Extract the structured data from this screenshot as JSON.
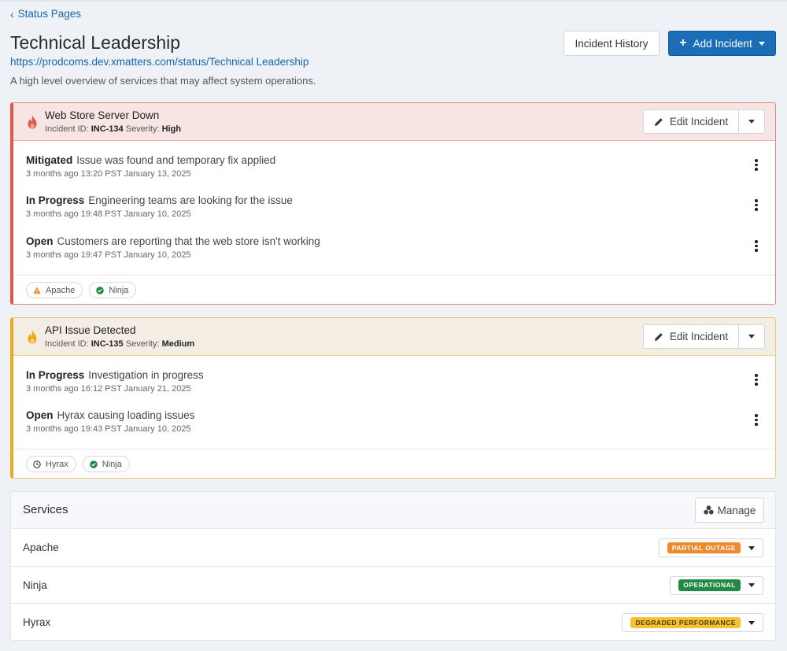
{
  "breadcrumb": {
    "label": "Status Pages"
  },
  "page": {
    "title": "Technical Leadership",
    "url": "https://prodcoms.dev.xmatters.com/status/Technical Leadership",
    "description": "A high level overview of services that may affect system operations."
  },
  "header_buttons": {
    "history": "Incident History",
    "add": "Add Incident"
  },
  "incidents": [
    {
      "title": "Web Store Server Down",
      "id_label": "Incident ID:",
      "id": "INC-134",
      "severity_label": "Severity:",
      "severity": "High",
      "edit_label": "Edit Incident",
      "accent": "#e2584a",
      "updates": [
        {
          "status": "Mitigated",
          "text": "Issue was found and temporary fix applied",
          "time": "3 months ago 13:20 PST January 13, 2025"
        },
        {
          "status": "In Progress",
          "text": "Engineering teams are looking for the issue",
          "time": "3 months ago 19:48 PST January 10, 2025"
        },
        {
          "status": "Open",
          "text": "Customers are reporting that the web store isn't working",
          "time": "3 months ago 19:47 PST January 10, 2025"
        }
      ],
      "tags": [
        {
          "label": "Apache",
          "icon": "warning-icon"
        },
        {
          "label": "Ninja",
          "icon": "check-circle-icon"
        }
      ]
    },
    {
      "title": "API Issue Detected",
      "id_label": "Incident ID:",
      "id": "INC-135",
      "severity_label": "Severity:",
      "severity": "Medium",
      "edit_label": "Edit Incident",
      "accent": "#f0a91b",
      "updates": [
        {
          "status": "In Progress",
          "text": "Investigation in progress",
          "time": "3 months ago 16:12 PST January 21, 2025"
        },
        {
          "status": "Open",
          "text": "Hyrax causing loading issues",
          "time": "3 months ago 19:43 PST January 10, 2025"
        }
      ],
      "tags": [
        {
          "label": "Hyrax",
          "icon": "clock-icon"
        },
        {
          "label": "Ninja",
          "icon": "check-circle-icon"
        }
      ]
    }
  ],
  "services": {
    "title": "Services",
    "manage_label": "Manage",
    "rows": [
      {
        "name": "Apache",
        "status": "PARTIAL OUTAGE",
        "color": "#ef8a2c",
        "text_color": "#ffffff"
      },
      {
        "name": "Ninja",
        "status": "OPERATIONAL",
        "color": "#1f8a44",
        "text_color": "#ffffff"
      },
      {
        "name": "Hyrax",
        "status": "DEGRADED PERFORMANCE",
        "color": "#f6c232",
        "text_color": "#4a3b00"
      }
    ]
  }
}
